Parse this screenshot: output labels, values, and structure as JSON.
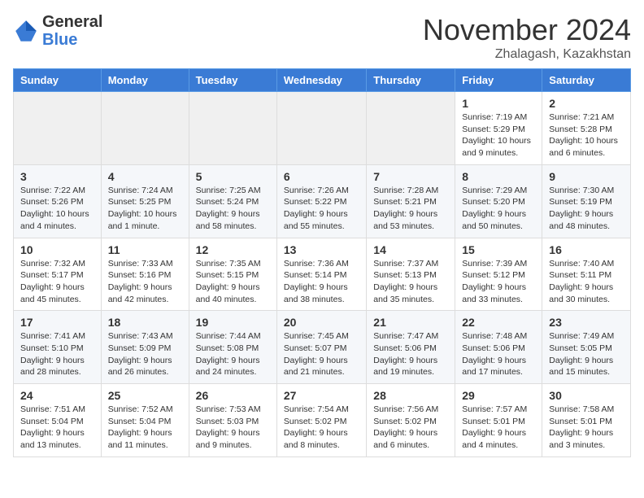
{
  "logo": {
    "general": "General",
    "blue": "Blue"
  },
  "header": {
    "month": "November 2024",
    "location": "Zhalagash, Kazakhstan"
  },
  "weekdays": [
    "Sunday",
    "Monday",
    "Tuesday",
    "Wednesday",
    "Thursday",
    "Friday",
    "Saturday"
  ],
  "weeks": [
    [
      {
        "day": "",
        "info": ""
      },
      {
        "day": "",
        "info": ""
      },
      {
        "day": "",
        "info": ""
      },
      {
        "day": "",
        "info": ""
      },
      {
        "day": "",
        "info": ""
      },
      {
        "day": "1",
        "info": "Sunrise: 7:19 AM\nSunset: 5:29 PM\nDaylight: 10 hours and 9 minutes."
      },
      {
        "day": "2",
        "info": "Sunrise: 7:21 AM\nSunset: 5:28 PM\nDaylight: 10 hours and 6 minutes."
      }
    ],
    [
      {
        "day": "3",
        "info": "Sunrise: 7:22 AM\nSunset: 5:26 PM\nDaylight: 10 hours and 4 minutes."
      },
      {
        "day": "4",
        "info": "Sunrise: 7:24 AM\nSunset: 5:25 PM\nDaylight: 10 hours and 1 minute."
      },
      {
        "day": "5",
        "info": "Sunrise: 7:25 AM\nSunset: 5:24 PM\nDaylight: 9 hours and 58 minutes."
      },
      {
        "day": "6",
        "info": "Sunrise: 7:26 AM\nSunset: 5:22 PM\nDaylight: 9 hours and 55 minutes."
      },
      {
        "day": "7",
        "info": "Sunrise: 7:28 AM\nSunset: 5:21 PM\nDaylight: 9 hours and 53 minutes."
      },
      {
        "day": "8",
        "info": "Sunrise: 7:29 AM\nSunset: 5:20 PM\nDaylight: 9 hours and 50 minutes."
      },
      {
        "day": "9",
        "info": "Sunrise: 7:30 AM\nSunset: 5:19 PM\nDaylight: 9 hours and 48 minutes."
      }
    ],
    [
      {
        "day": "10",
        "info": "Sunrise: 7:32 AM\nSunset: 5:17 PM\nDaylight: 9 hours and 45 minutes."
      },
      {
        "day": "11",
        "info": "Sunrise: 7:33 AM\nSunset: 5:16 PM\nDaylight: 9 hours and 42 minutes."
      },
      {
        "day": "12",
        "info": "Sunrise: 7:35 AM\nSunset: 5:15 PM\nDaylight: 9 hours and 40 minutes."
      },
      {
        "day": "13",
        "info": "Sunrise: 7:36 AM\nSunset: 5:14 PM\nDaylight: 9 hours and 38 minutes."
      },
      {
        "day": "14",
        "info": "Sunrise: 7:37 AM\nSunset: 5:13 PM\nDaylight: 9 hours and 35 minutes."
      },
      {
        "day": "15",
        "info": "Sunrise: 7:39 AM\nSunset: 5:12 PM\nDaylight: 9 hours and 33 minutes."
      },
      {
        "day": "16",
        "info": "Sunrise: 7:40 AM\nSunset: 5:11 PM\nDaylight: 9 hours and 30 minutes."
      }
    ],
    [
      {
        "day": "17",
        "info": "Sunrise: 7:41 AM\nSunset: 5:10 PM\nDaylight: 9 hours and 28 minutes."
      },
      {
        "day": "18",
        "info": "Sunrise: 7:43 AM\nSunset: 5:09 PM\nDaylight: 9 hours and 26 minutes."
      },
      {
        "day": "19",
        "info": "Sunrise: 7:44 AM\nSunset: 5:08 PM\nDaylight: 9 hours and 24 minutes."
      },
      {
        "day": "20",
        "info": "Sunrise: 7:45 AM\nSunset: 5:07 PM\nDaylight: 9 hours and 21 minutes."
      },
      {
        "day": "21",
        "info": "Sunrise: 7:47 AM\nSunset: 5:06 PM\nDaylight: 9 hours and 19 minutes."
      },
      {
        "day": "22",
        "info": "Sunrise: 7:48 AM\nSunset: 5:06 PM\nDaylight: 9 hours and 17 minutes."
      },
      {
        "day": "23",
        "info": "Sunrise: 7:49 AM\nSunset: 5:05 PM\nDaylight: 9 hours and 15 minutes."
      }
    ],
    [
      {
        "day": "24",
        "info": "Sunrise: 7:51 AM\nSunset: 5:04 PM\nDaylight: 9 hours and 13 minutes."
      },
      {
        "day": "25",
        "info": "Sunrise: 7:52 AM\nSunset: 5:04 PM\nDaylight: 9 hours and 11 minutes."
      },
      {
        "day": "26",
        "info": "Sunrise: 7:53 AM\nSunset: 5:03 PM\nDaylight: 9 hours and 9 minutes."
      },
      {
        "day": "27",
        "info": "Sunrise: 7:54 AM\nSunset: 5:02 PM\nDaylight: 9 hours and 8 minutes."
      },
      {
        "day": "28",
        "info": "Sunrise: 7:56 AM\nSunset: 5:02 PM\nDaylight: 9 hours and 6 minutes."
      },
      {
        "day": "29",
        "info": "Sunrise: 7:57 AM\nSunset: 5:01 PM\nDaylight: 9 hours and 4 minutes."
      },
      {
        "day": "30",
        "info": "Sunrise: 7:58 AM\nSunset: 5:01 PM\nDaylight: 9 hours and 3 minutes."
      }
    ]
  ]
}
